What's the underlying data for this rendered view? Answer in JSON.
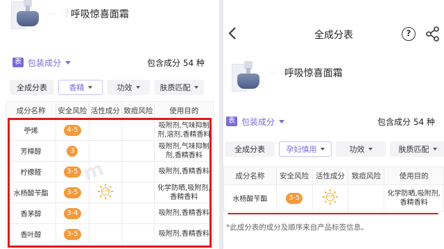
{
  "left": {
    "product_name": "呼吸惊喜面霜",
    "section_label": "包装成分",
    "table_icon": "表",
    "count_text": "包含成分 54 种",
    "filters": [
      {
        "label": "全成分表",
        "active": false,
        "dropdown": false
      },
      {
        "label": "香精",
        "active": true,
        "dropdown": true
      },
      {
        "label": "功效",
        "active": false,
        "dropdown": true
      },
      {
        "label": "肤质匹配",
        "active": false,
        "dropdown": true
      }
    ],
    "columns": [
      "成分名称",
      "安全风险",
      "活性成分",
      "致痘风险",
      "使用目的"
    ],
    "rows": [
      {
        "name": "苧烯",
        "risk": "4-5",
        "active": "",
        "acne": "",
        "purpose": "吸附剂,气味抑制剂,溶剂,香精香料"
      },
      {
        "name": "芳樟醇",
        "risk": "3",
        "active": "",
        "acne": "",
        "purpose": "吸附剂,气味抑制剂,香精香料"
      },
      {
        "name": "柠檬醛",
        "risk": "3-5",
        "active": "",
        "acne": "",
        "purpose": "吸附剂,香精香料"
      },
      {
        "name": "水杨酸苄酯",
        "risk": "3-5",
        "active": "sun-icon",
        "acne": "",
        "purpose": "化学防晒,吸附剂,香精香料"
      },
      {
        "name": "香茅醇",
        "risk": "3-4",
        "active": "",
        "acne": "",
        "purpose": "吸附剂,香精香料"
      },
      {
        "name": "香叶醇",
        "risk": "3-5",
        "active": "",
        "acne": "",
        "purpose": "吸附剂,香精香料"
      }
    ]
  },
  "right": {
    "title": "全成分表",
    "product_name": "呼吸惊喜面霜",
    "section_label": "包装成分",
    "table_icon": "表",
    "count_text": "包含成分 54 种",
    "filters": [
      {
        "label": "全成分表",
        "active": false,
        "dropdown": false
      },
      {
        "label": "孕妇慎用",
        "active": true,
        "dropdown": true
      },
      {
        "label": "功效",
        "active": false,
        "dropdown": true
      },
      {
        "label": "肤质匹配",
        "active": false,
        "dropdown": true
      }
    ],
    "columns": [
      "成分名称",
      "安全风险",
      "活性成分",
      "致痘风险",
      "使用目的"
    ],
    "rows": [
      {
        "name": "水杨酸苄酯",
        "risk": "3-5",
        "active": "sun-icon",
        "acne": "",
        "purpose": "化学防晒,吸附剂,香精香料"
      }
    ],
    "footnote": "*此成分表的成分及顺序来自产品标签信息。",
    "help_icon": "?"
  },
  "colors": {
    "accent": "#7a6ad8",
    "risk": "#f39a3b",
    "highlight": "#e01818"
  }
}
